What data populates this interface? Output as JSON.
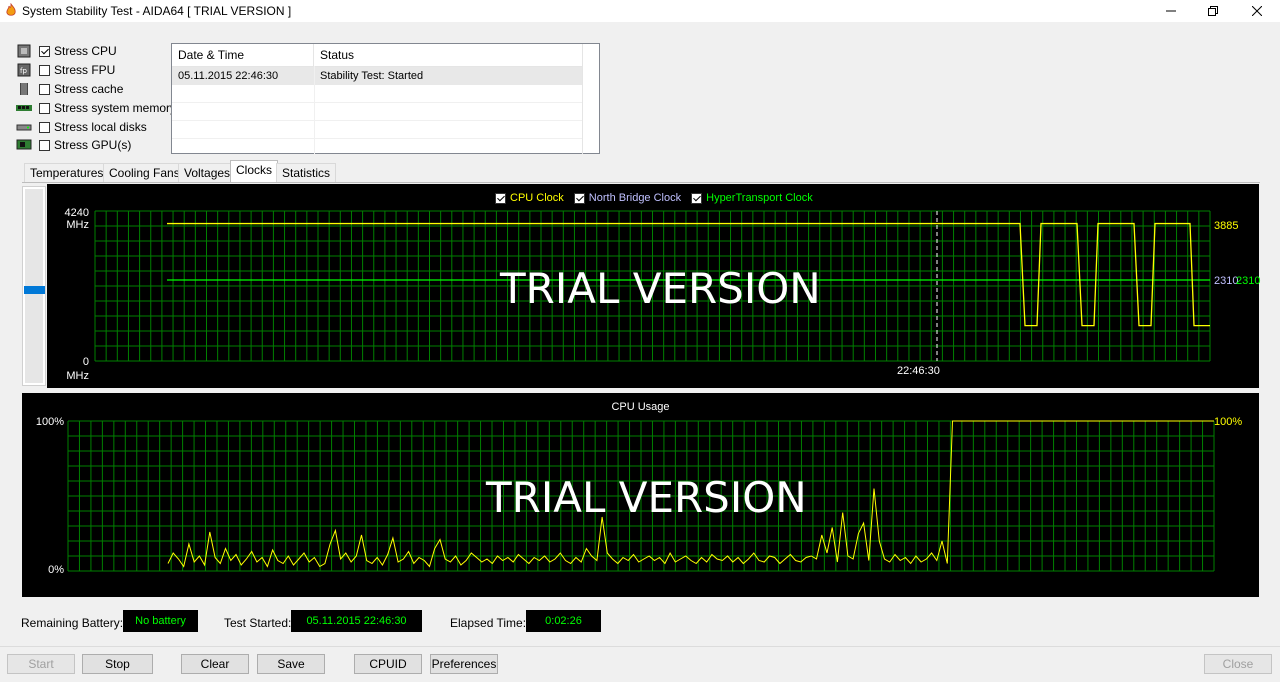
{
  "window": {
    "title": "System Stability Test - AIDA64  [ TRIAL VERSION ]"
  },
  "stress_options": [
    {
      "label": "Stress CPU",
      "checked": true,
      "icon": "cpu-icon"
    },
    {
      "label": "Stress FPU",
      "checked": false,
      "icon": "fpu-icon"
    },
    {
      "label": "Stress cache",
      "checked": false,
      "icon": "cache-icon"
    },
    {
      "label": "Stress system memory",
      "checked": false,
      "icon": "memory-icon"
    },
    {
      "label": "Stress local disks",
      "checked": false,
      "icon": "disk-icon"
    },
    {
      "label": "Stress GPU(s)",
      "checked": false,
      "icon": "gpu-icon"
    }
  ],
  "log": {
    "headers": [
      "Date & Time",
      "Status"
    ],
    "rows": [
      {
        "datetime": "05.11.2015 22:46:30",
        "status": "Stability Test: Started"
      }
    ]
  },
  "tabs": [
    "Temperatures",
    "Cooling Fans",
    "Voltages",
    "Clocks",
    "Statistics"
  ],
  "active_tab": "Clocks",
  "clock_graph": {
    "legend": [
      {
        "label": "CPU Clock",
        "color": "#ffff00",
        "checked": true
      },
      {
        "label": "North Bridge Clock",
        "color": "#c0c0ff",
        "checked": true
      },
      {
        "label": "HyperTransport Clock",
        "color": "#00ff00",
        "checked": true
      }
    ],
    "y_max": "4240",
    "y_max_unit": "MHz",
    "y_min": "0",
    "y_min_unit": "MHz",
    "marker_time": "22:46:30",
    "right_label_cpu": "3885",
    "right_label_nb": "2310",
    "right_label_ht": "2310",
    "watermark": "TRIAL VERSION"
  },
  "usage_graph": {
    "title": "CPU Usage",
    "y_max": "100%",
    "y_min": "0%",
    "right_label": "100%",
    "watermark": "TRIAL VERSION"
  },
  "chart_data": [
    {
      "type": "line",
      "title": "",
      "ylabel": "MHz",
      "ylim": [
        0,
        4240
      ],
      "series": [
        {
          "name": "CPU Clock",
          "values_before_test": [
            3885
          ],
          "values_after_test": [
            3885,
            1000,
            3885,
            1000,
            3885,
            1000,
            3885,
            1000
          ]
        },
        {
          "name": "North Bridge Clock",
          "values": [
            2310
          ]
        },
        {
          "name": "HyperTransport Clock",
          "values": [
            2310
          ]
        }
      ]
    },
    {
      "type": "line",
      "title": "CPU Usage",
      "ylim": [
        0,
        100
      ],
      "series": [
        {
          "name": "CPU Usage",
          "values": [
            5,
            12,
            8,
            3,
            18,
            6,
            10,
            4,
            26,
            9,
            5,
            15,
            7,
            11,
            4,
            8,
            13,
            6,
            9,
            3,
            14,
            7,
            5,
            10,
            4,
            8,
            12,
            6,
            9,
            3,
            5,
            18,
            27,
            8,
            12,
            6,
            10,
            24,
            7,
            5,
            9,
            4,
            11,
            22,
            6,
            8,
            13,
            5,
            9,
            7,
            3,
            15,
            21,
            8,
            6,
            10,
            4,
            7,
            12,
            9,
            6,
            8,
            5,
            10,
            7,
            9,
            6,
            11,
            8,
            5,
            9,
            7,
            10,
            6,
            8,
            12,
            7,
            5,
            9,
            6,
            15,
            10,
            7,
            36,
            12,
            8,
            5,
            9,
            7,
            11,
            6,
            8,
            10,
            7,
            9,
            5,
            12,
            6,
            8,
            10,
            7,
            5,
            9,
            6,
            11,
            8,
            7,
            10,
            6,
            9,
            5,
            8,
            12,
            7,
            6,
            10,
            9,
            5,
            8,
            11,
            7,
            6,
            9,
            10,
            8,
            24,
            12,
            29,
            6,
            39,
            10,
            8,
            25,
            32,
            7,
            55,
            20,
            8,
            6,
            11,
            7,
            9,
            5,
            10,
            6,
            8,
            12,
            7,
            20,
            5,
            100,
            100,
            100,
            100,
            100,
            100,
            100,
            100,
            100,
            100,
            100,
            100,
            100,
            100,
            100,
            100,
            100,
            100,
            100,
            100,
            100,
            100,
            100,
            100,
            100,
            100,
            100,
            100,
            100,
            100,
            100,
            100,
            100,
            100,
            100,
            100,
            100,
            100,
            100,
            100,
            100,
            100,
            100,
            100,
            100,
            100,
            100,
            100,
            100,
            100,
            100
          ]
        }
      ]
    }
  ],
  "status": {
    "battery_label": "Remaining Battery:",
    "battery_value": "No battery",
    "started_label": "Test Started:",
    "started_value": "05.11.2015 22:46:30",
    "elapsed_label": "Elapsed Time:",
    "elapsed_value": "0:02:26"
  },
  "buttons": {
    "start": "Start",
    "stop": "Stop",
    "clear": "Clear",
    "save": "Save",
    "cpuid": "CPUID",
    "preferences": "Preferences",
    "close": "Close"
  }
}
